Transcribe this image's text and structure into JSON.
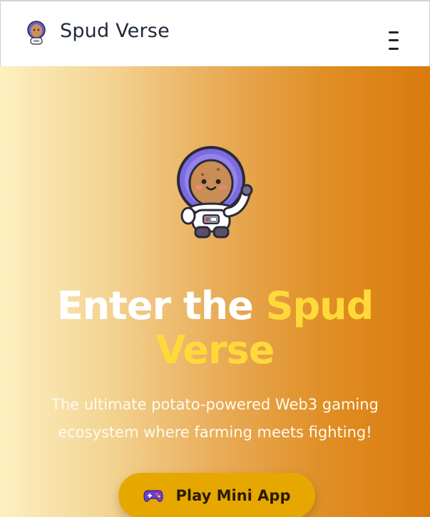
{
  "header": {
    "brand": "Spud Verse",
    "logo_icon": "astronaut-potato-logo-icon",
    "menu_icon": "hamburger-menu-icon"
  },
  "hero": {
    "title_white": "Enter the ",
    "title_yellow_1": "Spud",
    "title_yellow_2": "Verse",
    "subtitle_line1": "The ultimate potato-powered Web3 gaming",
    "subtitle_line2": "ecosystem where farming meets fighting!",
    "cta_label": "Play Mini App",
    "cta_icon": "gamepad-icon"
  },
  "colors": {
    "accent_yellow": "#ffd93a",
    "cta_background": "#e6a800",
    "gradient_start": "#fdf0c0",
    "gradient_end": "#d97a0c"
  }
}
